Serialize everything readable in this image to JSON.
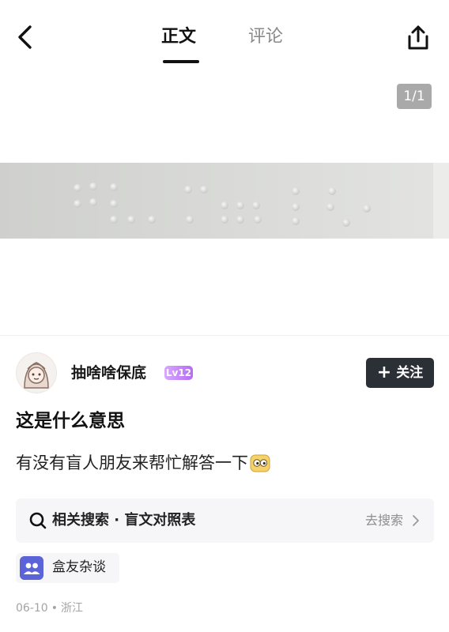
{
  "nav": {
    "tabs": [
      {
        "label": "正文",
        "active": true
      },
      {
        "label": "评论",
        "active": false
      }
    ],
    "icons": {
      "back": "back-arrow-icon",
      "share": "share-icon"
    }
  },
  "gallery": {
    "page_counter": "1/1",
    "image_description_icon": "braille-photo"
  },
  "author": {
    "name": "抽啥啥保底",
    "level": "Lv12",
    "follow_plus": "+",
    "follow_label": "关注"
  },
  "post": {
    "title": "这是什么意思",
    "body": "有没有盲人朋友来帮忙解答一下"
  },
  "related_search": {
    "label": "相关搜索 · 盲文对照表",
    "action": "去搜索"
  },
  "circle": {
    "label": "盒友杂谈"
  },
  "meta": {
    "date": "06-10",
    "separator": "•",
    "location": "浙江"
  },
  "colors": {
    "follow_button": "#2b2f36",
    "level_badge": "#b56cf5",
    "circle_icon": "#5a63d8",
    "page_counter": "#a9a9a9"
  }
}
